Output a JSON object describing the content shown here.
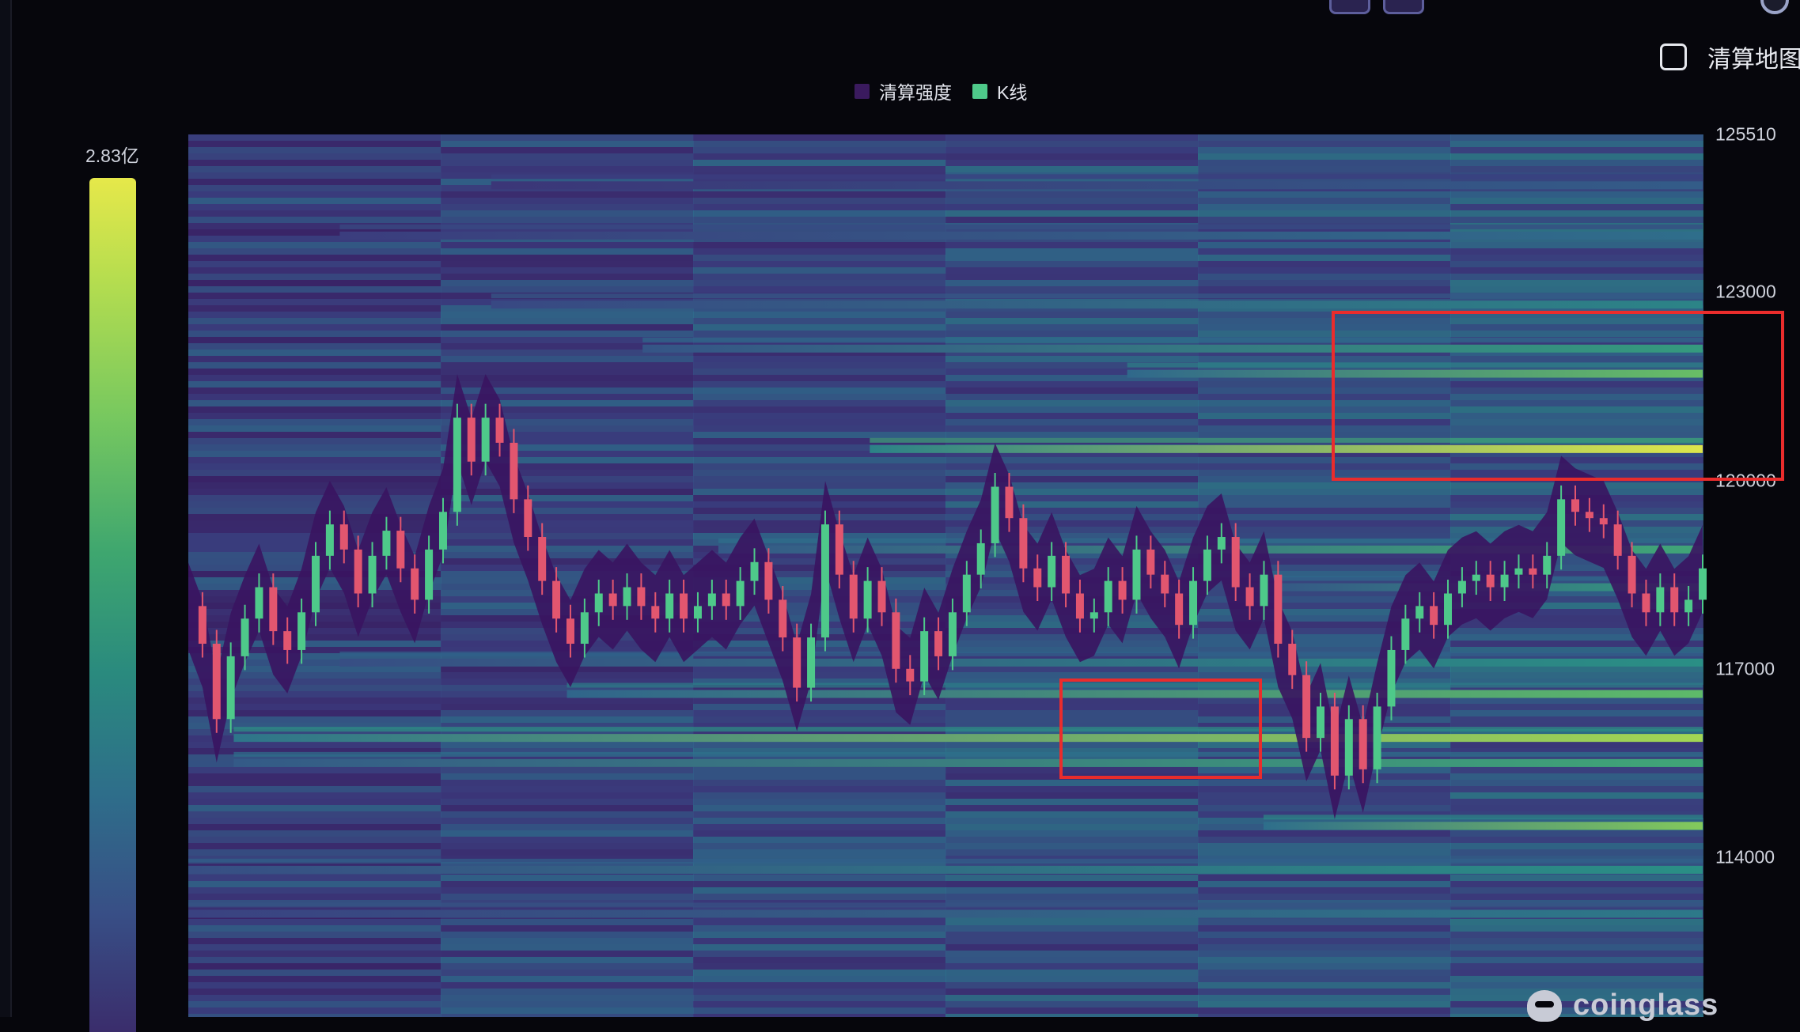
{
  "toggle": {
    "label": "清算地图"
  },
  "colorbar": {
    "max_label": "2.83亿",
    "top_color": "#e6e84a",
    "bottom_color": "#3a2d6c"
  },
  "watermark": {
    "brand": "coinglass"
  },
  "chart_data": {
    "type": "heatmap",
    "title": "",
    "xlabel": "",
    "ylabel": "",
    "legend": {
      "placement": "top-center",
      "items": [
        {
          "name": "清算强度",
          "color": "#3a1a5e"
        },
        {
          "name": "K线",
          "color": "#4ec98a"
        }
      ]
    },
    "ylim": [
      112300,
      125510
    ],
    "y_axis_position": "right",
    "y_ticks": [
      "125510",
      "123000",
      "120000",
      "117000",
      "114000"
    ],
    "y_tick_values": [
      125510,
      123000,
      120000,
      117000,
      114000
    ],
    "grid": false,
    "colorbar_max": "2.83亿",
    "colormap": [
      "#3a1a5e",
      "#3b3f80",
      "#2f6a8c",
      "#2a8f85",
      "#4fb36e",
      "#9cd454",
      "#e6e84a"
    ],
    "heat_bands": [
      {
        "price": 120500,
        "intensity": 0.98,
        "from": 0.45
      },
      {
        "price": 121700,
        "intensity": 0.72,
        "from": 0.62
      },
      {
        "price": 122100,
        "intensity": 0.55,
        "from": 0.3
      },
      {
        "price": 122800,
        "intensity": 0.45,
        "from": 0.2
      },
      {
        "price": 123900,
        "intensity": 0.35,
        "from": 0.1
      },
      {
        "price": 124700,
        "intensity": 0.28,
        "from": 0.2
      },
      {
        "price": 115900,
        "intensity": 0.85,
        "from": 0.03
      },
      {
        "price": 115500,
        "intensity": 0.6,
        "from": 0.03
      },
      {
        "price": 116600,
        "intensity": 0.7,
        "from": 0.25
      },
      {
        "price": 117100,
        "intensity": 0.5,
        "from": 0.1
      },
      {
        "price": 114500,
        "intensity": 0.78,
        "from": 0.71
      },
      {
        "price": 113800,
        "intensity": 0.5,
        "from": 0.0
      },
      {
        "price": 113100,
        "intensity": 0.4,
        "from": 0.0
      },
      {
        "price": 118900,
        "intensity": 0.6,
        "from": 0.35
      },
      {
        "price": 118300,
        "intensity": 0.55,
        "from": 0.7
      }
    ],
    "price_path": [
      118000,
      117400,
      116200,
      117200,
      117800,
      118300,
      117600,
      117300,
      117900,
      118800,
      119300,
      118900,
      118200,
      118800,
      119200,
      118600,
      118100,
      118900,
      119500,
      121000,
      120300,
      121000,
      120600,
      119700,
      119100,
      118400,
      117800,
      117400,
      117900,
      118200,
      118000,
      118300,
      118000,
      117800,
      118200,
      117800,
      118000,
      118200,
      118000,
      118400,
      118700,
      118100,
      117500,
      116700,
      117500,
      119300,
      118500,
      117800,
      118400,
      117900,
      117000,
      116800,
      117600,
      117200,
      117900,
      118500,
      119000,
      119900,
      119400,
      118600,
      118300,
      118800,
      118200,
      117800,
      117900,
      118400,
      118100,
      118900,
      118500,
      118200,
      117700,
      118400,
      118900,
      119100,
      118300,
      118000,
      118500,
      117400,
      116900,
      115900,
      116400,
      115300,
      116200,
      115400,
      116400,
      117300,
      117800,
      118000,
      117700,
      118200,
      118400,
      118500,
      118300,
      118500,
      118600,
      118500,
      118800,
      119700,
      119500,
      119400,
      119300,
      118800,
      118200,
      117900,
      118300,
      117900,
      118100,
      118600
    ],
    "highlight_boxes": [
      {
        "x_from": 0.755,
        "x_to": 1.0,
        "y_from": 122700,
        "y_to": 120000,
        "color": "#ea2c2c"
      },
      {
        "x_from": 0.575,
        "x_to": 0.709,
        "y_from": 116850,
        "y_to": 115250,
        "color": "#ea2c2c"
      }
    ]
  }
}
